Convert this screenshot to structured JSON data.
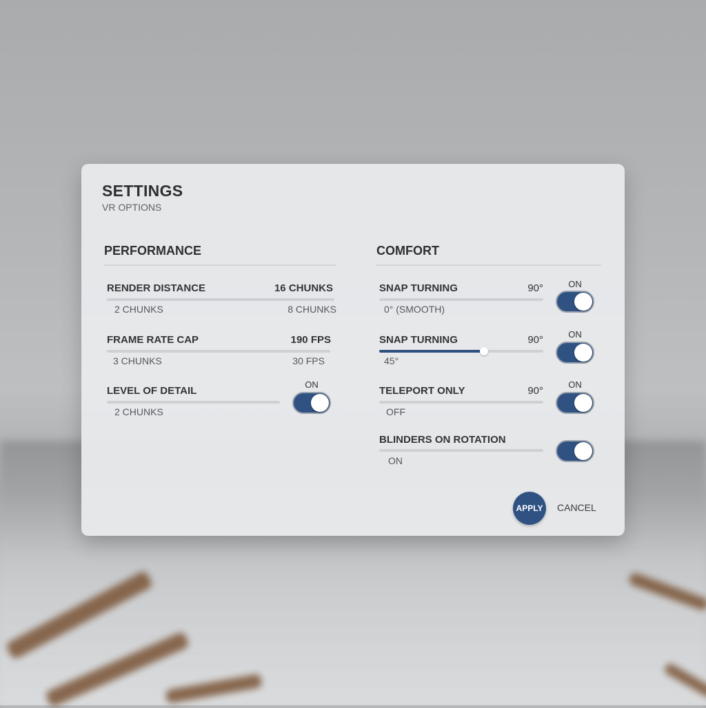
{
  "dialog": {
    "title": "SETTINGS",
    "subtitle": "VR OPTIONS"
  },
  "performance": {
    "heading": "PERFORMANCE",
    "items": [
      {
        "label": "RENDER DISTANCE",
        "value": "16 CHUNKS",
        "min_label": "2 CHUNKS",
        "max_label": "8 CHUNKS"
      },
      {
        "label": "FRAME RATE CAP",
        "value": "190 FPS",
        "min_label": "3 CHUNKS",
        "max_label": "30 FPS"
      },
      {
        "label": "LEVEL OF DETAIL",
        "sub_label": "2 CHUNKS",
        "toggle_label": "ON",
        "toggle_on": true
      }
    ]
  },
  "comfort": {
    "heading": "COMFORT",
    "items": [
      {
        "label": "SNAP TURNING",
        "value": "90°",
        "sub_label": "0° (SMOOTH)",
        "toggle_label": "ON",
        "toggle_on": true
      },
      {
        "label": "SNAP TURNING",
        "value": "90°",
        "sub_label": "45°",
        "slider_level": 0.64,
        "toggle_label": "ON",
        "toggle_on": true
      },
      {
        "label": "TELEPORT ONLY",
        "value": "90°",
        "sub_label": "OFF",
        "toggle_label": "ON",
        "toggle_on": true
      },
      {
        "label": "BLINDERS ON ROTATION",
        "sub_label": "ON",
        "toggle_on": true
      }
    ]
  },
  "actions": {
    "apply_label": "APPLY",
    "cancel_label": "CANCEL"
  },
  "colors": {
    "accent": "#2f5283",
    "panel": "#e8e9eb"
  }
}
